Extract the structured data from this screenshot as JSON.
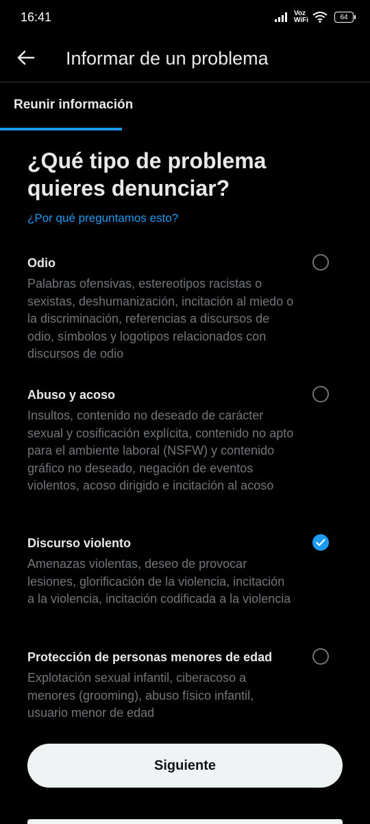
{
  "status": {
    "time": "16:41",
    "voz": "Voz",
    "wifi": "WiFi",
    "battery": "64"
  },
  "header": {
    "title": "Informar de un problema"
  },
  "step": {
    "label": "Reunir información"
  },
  "question": {
    "title": "¿Qué tipo de problema quieres denunciar?",
    "why_link": "¿Por qué preguntamos esto?"
  },
  "options": [
    {
      "title": "Odio",
      "description": "Palabras ofensivas, estereotipos racistas o sexistas, deshumanización, incitación al miedo o la discriminación, referencias a discursos de odio, símbolos y logotipos relacionados con discursos de odio",
      "selected": false
    },
    {
      "title": "Abuso y acoso",
      "description": "Insultos, contenido no deseado de carácter sexual y cosificación explícita, contenido no apto para el ambiente laboral (NSFW) y contenido gráfico no deseado, negación de eventos violentos, acoso dirigido e incitación al acoso",
      "selected": false
    },
    {
      "title": "Discurso violento",
      "description": "Amenazas violentas, deseo de provocar lesiones, glorificación de la violencia, incitación a la violencia, incitación codificada a la violencia",
      "selected": true
    },
    {
      "title": "Protección de personas menores de edad",
      "description": "Explotación sexual infantil, ciberacoso a menores (grooming), abuso físico infantil, usuario menor de edad",
      "selected": false
    }
  ],
  "footer": {
    "next_label": "Siguiente"
  },
  "colors": {
    "accent": "#1d9bf0",
    "background": "#000000",
    "muted_text": "#71767b"
  }
}
